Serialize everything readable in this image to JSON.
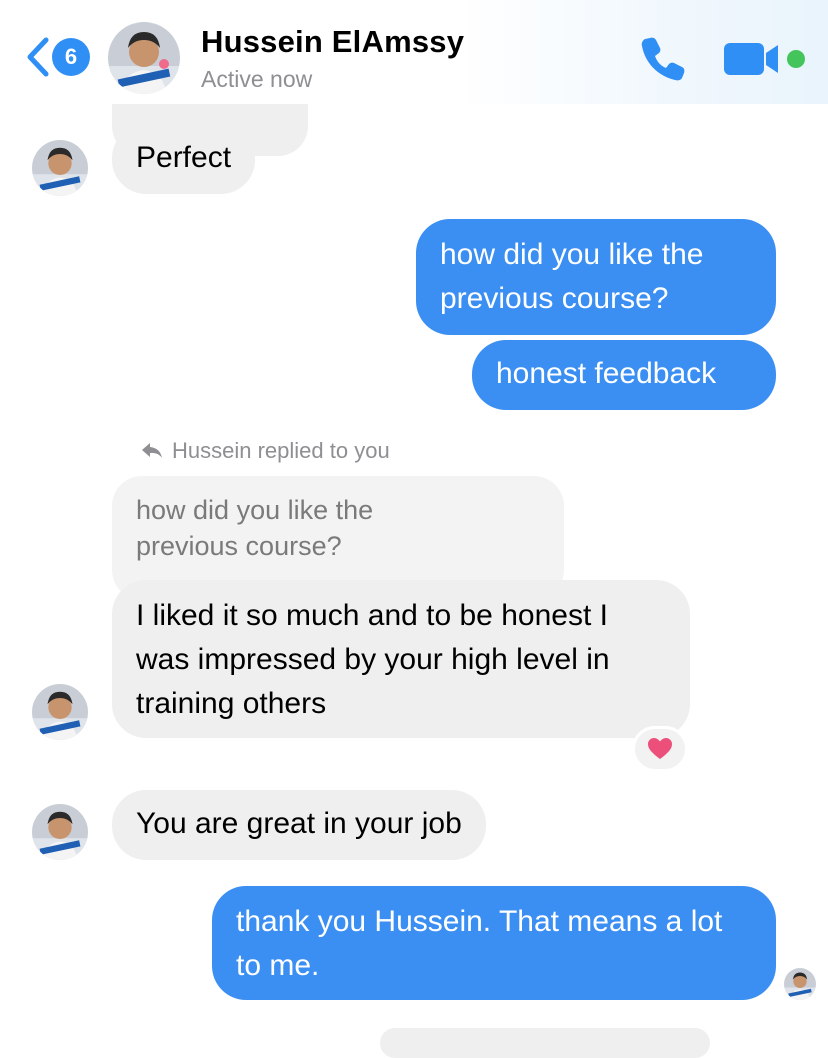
{
  "header": {
    "back_count": "6",
    "contact_name": "Hussein ElAmssy",
    "status": "Active now",
    "call_icon": "phone-icon",
    "video_icon": "video-camera-icon",
    "online_color": "#44c55c"
  },
  "theme": {
    "outgoing_bubble": "#3b8ff3",
    "incoming_bubble": "#efefef",
    "accent": "#2f8ff5"
  },
  "messages": [
    {
      "id": "m1",
      "side": "incoming",
      "text": "Perfect"
    },
    {
      "id": "m2",
      "side": "outgoing",
      "text": "how did you like the previous course?"
    },
    {
      "id": "m3",
      "side": "outgoing",
      "text": "honest feedback"
    },
    {
      "id": "m4",
      "side": "incoming",
      "reply_label": "Hussein replied to you",
      "quoted_text": "how did you like the previous course?",
      "text": "I liked it so much and to be honest I was impressed by your high level in training others",
      "reaction": "heart-icon"
    },
    {
      "id": "m5",
      "side": "incoming",
      "text": "You are great in your job"
    },
    {
      "id": "m6",
      "side": "outgoing",
      "text": "thank you Hussein. That means a lot to me."
    }
  ]
}
